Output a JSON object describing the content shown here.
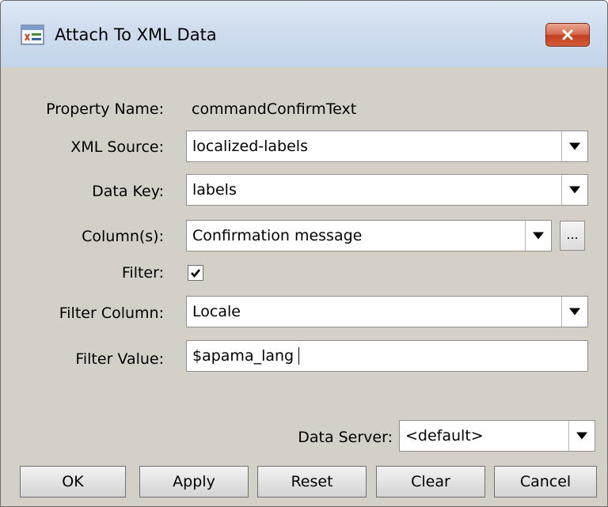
{
  "window": {
    "title": "Attach To XML Data"
  },
  "form": {
    "property_name": {
      "label": "Property Name:",
      "value": "commandConfirmText"
    },
    "xml_source": {
      "label": "XML Source:",
      "value": "localized-labels"
    },
    "data_key": {
      "label": "Data Key:",
      "value": "labels"
    },
    "columns": {
      "label": "Column(s):",
      "value": "Confirmation message",
      "browse_label": "..."
    },
    "filter": {
      "label": "Filter:",
      "checked": true
    },
    "filter_column": {
      "label": "Filter Column:",
      "value": "Locale"
    },
    "filter_value": {
      "label": "Filter Value:",
      "value": "$apama_lang"
    },
    "data_server": {
      "label": "Data Server:",
      "value": "<default>"
    }
  },
  "buttons": {
    "ok": "OK",
    "apply": "Apply",
    "reset": "Reset",
    "clear": "Clear",
    "cancel": "Cancel"
  },
  "icons": {
    "app": "xml-data-window-icon",
    "close": "close-icon",
    "dropdown": "chevron-down-icon",
    "check": "checkmark-icon"
  },
  "colors": {
    "dialog_bg": "#d4d0c8",
    "titlebar": "#cfdcee",
    "close_button": "#c9472a"
  }
}
